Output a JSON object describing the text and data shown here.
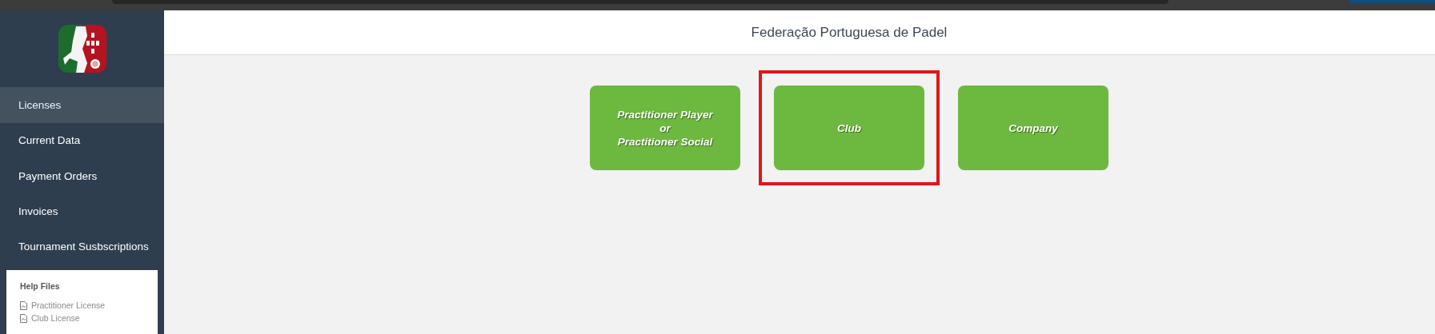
{
  "header": {
    "title": "Federação Portuguesa de Padel"
  },
  "sidebar": {
    "items": [
      {
        "label": "Licenses",
        "selected": true
      },
      {
        "label": "Current Data",
        "selected": false
      },
      {
        "label": "Payment Orders",
        "selected": false
      },
      {
        "label": "Invoices",
        "selected": false
      },
      {
        "label": "Tournament Susbscriptions",
        "selected": false
      }
    ],
    "help": {
      "title": "Help Files",
      "files": [
        "Practitioner License",
        "Club License"
      ]
    }
  },
  "options": [
    {
      "lines": [
        "Practitioner Player",
        "or",
        "Practitioner Social"
      ],
      "highlighted": false
    },
    {
      "lines": [
        "Club"
      ],
      "highlighted": true
    },
    {
      "lines": [
        "Company"
      ],
      "highlighted": false
    }
  ]
}
